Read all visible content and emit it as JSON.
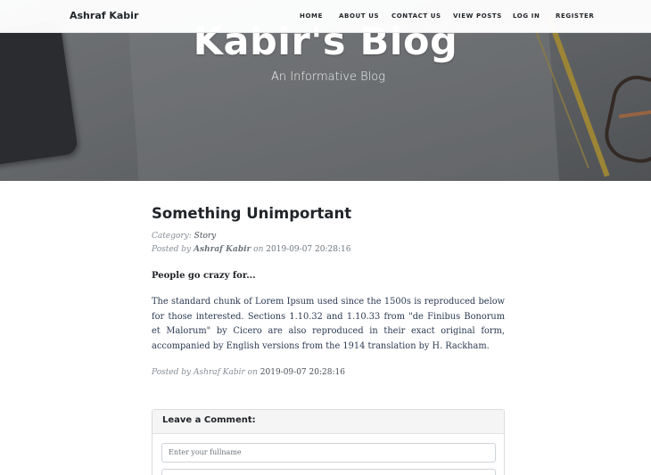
{
  "navbar": {
    "brand": "Ashraf Kabir",
    "links": [
      "HOME",
      "ABOUT US",
      "CONTACT US",
      "VIEW POSTS",
      "LOG IN",
      "REGISTER"
    ]
  },
  "hero": {
    "title": "Kabir's Blog",
    "subtitle": "An Informative Blog"
  },
  "post": {
    "title": "Something Unimportant",
    "category_label": "Category:",
    "category": "Story",
    "posted_by_label": "Posted by",
    "author": "Ashraf Kabir",
    "on_label": "on",
    "date": "2019-09-07 20:28:16",
    "lead": "People go crazy for...",
    "body": "The standard chunk of Lorem Ipsum used since the 1500s is reproduced below for those interested. Sections 1.10.32 and 1.10.33 from \"de Finibus Bonorum et Malorum\" by Cicero are also reproduced in their exact original form, accompanied by English versions from the 1914 translation by H. Rackham.",
    "footer_posted_by": "Posted by Ashraf Kabir on",
    "footer_date": "2019-09-07 20:28:16"
  },
  "comment": {
    "header": "Leave a Comment:",
    "fullname_placeholder": "Enter your fullname"
  }
}
